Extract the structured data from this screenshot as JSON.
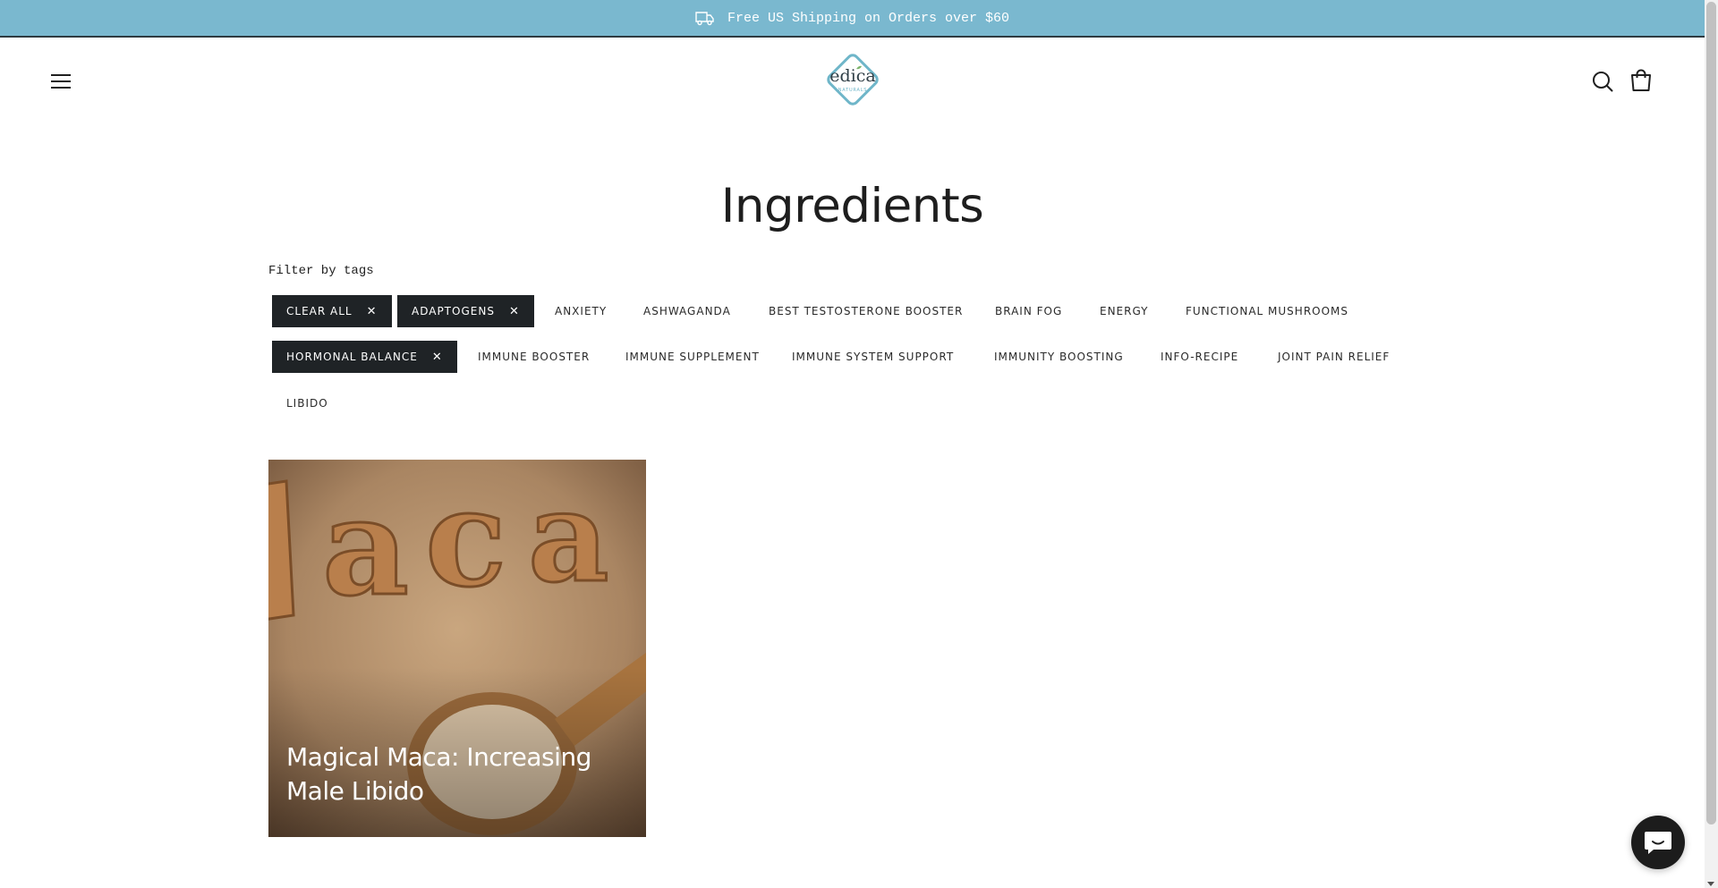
{
  "announcement": {
    "text": "Free US Shipping on Orders over $60",
    "icon": "truck-icon"
  },
  "header": {
    "menu_icon": "hamburger-menu-icon",
    "logo": {
      "brand": "edica",
      "sub": "NATURALS"
    },
    "search_icon": "search-icon",
    "cart_icon": "shopping-bag-icon"
  },
  "page": {
    "title": "Ingredients",
    "filter_label": "Filter by tags"
  },
  "tags": [
    {
      "label": "CLEAR ALL",
      "active": true,
      "remove": "✕"
    },
    {
      "label": "ADAPTOGENS",
      "active": true,
      "remove": "✕"
    },
    {
      "label": "ANXIETY",
      "active": false
    },
    {
      "label": "ASHWAGANDA",
      "active": false
    },
    {
      "label": "BEST TESTOSTERONE BOOSTER",
      "active": false
    },
    {
      "label": "BRAIN FOG",
      "active": false
    },
    {
      "label": "ENERGY",
      "active": false
    },
    {
      "label": "FUNCTIONAL MUSHROOMS",
      "active": false
    },
    {
      "label": "HORMONAL BALANCE",
      "active": true,
      "remove": "✕"
    },
    {
      "label": "IMMUNE BOOSTER",
      "active": false
    },
    {
      "label": "IMMUNE SUPPLEMENT",
      "active": false
    },
    {
      "label": "IMMUNE SYSTEM SUPPORT",
      "active": false
    },
    {
      "label": "IMMUNITY BOOSTING",
      "active": false
    },
    {
      "label": "INFO-RECIPE",
      "active": false
    },
    {
      "label": "JOINT PAIN RELIEF",
      "active": false
    },
    {
      "label": "LIBIDO",
      "active": false
    }
  ],
  "articles": [
    {
      "title": "Magical Maca: Increasing Male Libido"
    }
  ],
  "chat": {
    "icon": "chat-bubble-icon"
  },
  "colors": {
    "announcement_bg": "#7ab8cf",
    "active_tag_bg": "#1f2326",
    "logo_teal": "#6fb6c9"
  }
}
